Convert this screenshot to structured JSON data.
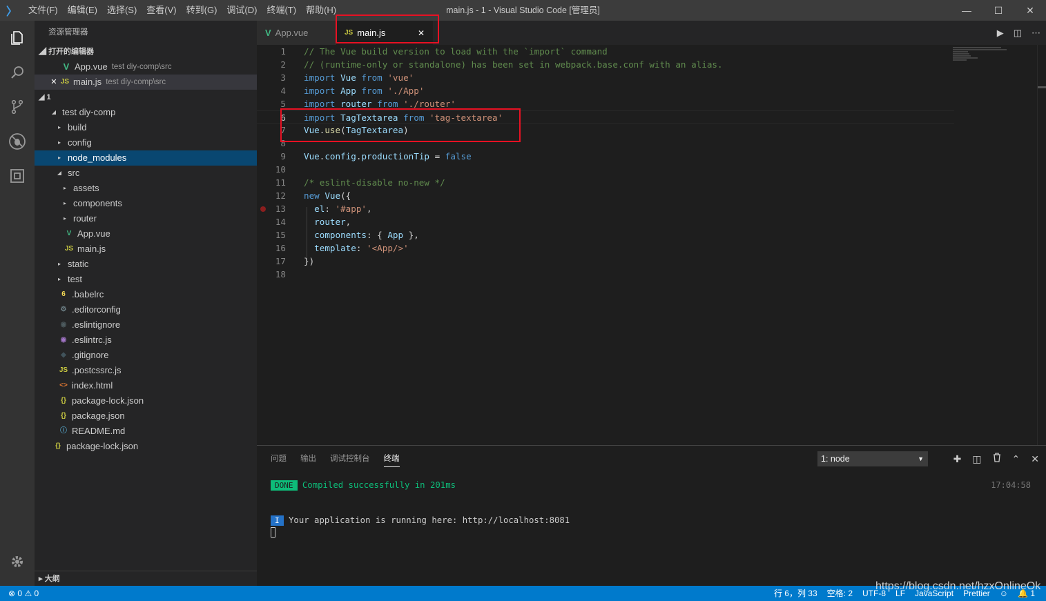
{
  "titlebar": {
    "logo": "〉",
    "menus": [
      "文件(F)",
      "编辑(E)",
      "选择(S)",
      "查看(V)",
      "转到(G)",
      "调试(D)",
      "终端(T)",
      "帮助(H)"
    ],
    "title": "main.js - 1 - Visual Studio Code [管理员]",
    "minimize": "—",
    "maximize": "☐",
    "close": "✕"
  },
  "sidebar": {
    "title": "资源管理器",
    "open_editors_header": "打开的编辑器",
    "open_editors": [
      {
        "name": "App.vue",
        "path": "test diy-comp\\src",
        "icon": "vue-icon",
        "glyph": "V"
      },
      {
        "name": "main.js",
        "path": "test diy-comp\\src",
        "icon": "js-icon",
        "glyph": "JS",
        "close": "✕"
      }
    ],
    "workspace_header": "1",
    "tree": [
      {
        "label": "test diy-comp",
        "kind": "folder-open",
        "depth": 1
      },
      {
        "label": "build",
        "kind": "folder",
        "depth": 2
      },
      {
        "label": "config",
        "kind": "folder",
        "depth": 2
      },
      {
        "label": "node_modules",
        "kind": "folder",
        "depth": 2,
        "selected": true
      },
      {
        "label": "src",
        "kind": "folder-open",
        "depth": 2
      },
      {
        "label": "assets",
        "kind": "folder",
        "depth": 3
      },
      {
        "label": "components",
        "kind": "folder",
        "depth": 3
      },
      {
        "label": "router",
        "kind": "folder",
        "depth": 3
      },
      {
        "label": "App.vue",
        "kind": "vue",
        "depth": 3
      },
      {
        "label": "main.js",
        "kind": "js",
        "depth": 3
      },
      {
        "label": "static",
        "kind": "folder",
        "depth": 2
      },
      {
        "label": "test",
        "kind": "folder",
        "depth": 2
      },
      {
        "label": ".babelrc",
        "kind": "babel",
        "depth": 2
      },
      {
        "label": ".editorconfig",
        "kind": "gear",
        "depth": 2
      },
      {
        "label": ".eslintignore",
        "kind": "eslint-gray",
        "depth": 2
      },
      {
        "label": ".eslintrc.js",
        "kind": "eslint",
        "depth": 2
      },
      {
        "label": ".gitignore",
        "kind": "git",
        "depth": 2
      },
      {
        "label": ".postcssrc.js",
        "kind": "js",
        "depth": 2
      },
      {
        "label": "index.html",
        "kind": "html",
        "depth": 2
      },
      {
        "label": "package-lock.json",
        "kind": "json",
        "depth": 2
      },
      {
        "label": "package.json",
        "kind": "json",
        "depth": 2
      },
      {
        "label": "README.md",
        "kind": "info",
        "depth": 2
      },
      {
        "label": "package-lock.json",
        "kind": "json",
        "depth": 1
      }
    ],
    "outline_header": "大纲"
  },
  "tabs": [
    {
      "label": "App.vue",
      "icon": "vue-icon",
      "glyph": "V",
      "active": false
    },
    {
      "label": "main.js",
      "icon": "js-icon",
      "glyph": "JS",
      "active": true,
      "close": "✕"
    }
  ],
  "editor_actions": {
    "run": "▶",
    "split": "◫",
    "more": "⋯"
  },
  "code": [
    {
      "n": "1",
      "t": [
        [
          "cm",
          "// The Vue build version to load with the `import` command"
        ]
      ]
    },
    {
      "n": "2",
      "t": [
        [
          "cm",
          "// (runtime-only or standalone) has been set in webpack.base.conf with an alias."
        ]
      ]
    },
    {
      "n": "3",
      "t": [
        [
          "kw",
          "import "
        ],
        [
          "vr",
          "Vue "
        ],
        [
          "kw",
          "from "
        ],
        [
          "st",
          "'vue'"
        ]
      ]
    },
    {
      "n": "4",
      "t": [
        [
          "kw",
          "import "
        ],
        [
          "vr",
          "App "
        ],
        [
          "kw",
          "from "
        ],
        [
          "st",
          "'./App'"
        ]
      ]
    },
    {
      "n": "5",
      "t": [
        [
          "kw",
          "import "
        ],
        [
          "vr",
          "router "
        ],
        [
          "kw",
          "from "
        ],
        [
          "st",
          "'./router'"
        ]
      ]
    },
    {
      "n": "6",
      "t": [
        [
          "kw",
          "import "
        ],
        [
          "vr",
          "TagTextarea "
        ],
        [
          "kw",
          "from "
        ],
        [
          "st",
          "'tag-textarea'"
        ]
      ]
    },
    {
      "n": "7",
      "t": [
        [
          "vr",
          "Vue"
        ],
        [
          "tx",
          "."
        ],
        [
          "fn",
          "use"
        ],
        [
          "tx",
          "("
        ],
        [
          "vr",
          "TagTextarea"
        ],
        [
          "tx",
          ")"
        ]
      ]
    },
    {
      "n": "8",
      "t": []
    },
    {
      "n": "9",
      "t": [
        [
          "vr",
          "Vue"
        ],
        [
          "tx",
          "."
        ],
        [
          "vr",
          "config"
        ],
        [
          "tx",
          "."
        ],
        [
          "vr",
          "productionTip"
        ],
        [
          "tx",
          " = "
        ],
        [
          "kw",
          "false"
        ]
      ]
    },
    {
      "n": "10",
      "t": []
    },
    {
      "n": "11",
      "t": [
        [
          "cm",
          "/* eslint-disable no-new */"
        ]
      ]
    },
    {
      "n": "12",
      "t": [
        [
          "kw",
          "new "
        ],
        [
          "vr",
          "Vue"
        ],
        [
          "tx",
          "({"
        ]
      ]
    },
    {
      "n": "13",
      "t": [
        [
          "tx",
          "  "
        ],
        [
          "vr",
          "el"
        ],
        [
          "tx",
          ": "
        ],
        [
          "st",
          "'#app'"
        ],
        [
          "tx",
          ","
        ]
      ]
    },
    {
      "n": "14",
      "t": [
        [
          "tx",
          "  "
        ],
        [
          "vr",
          "router"
        ],
        [
          "tx",
          ","
        ]
      ]
    },
    {
      "n": "15",
      "t": [
        [
          "tx",
          "  "
        ],
        [
          "vr",
          "components"
        ],
        [
          "tx",
          ": { "
        ],
        [
          "vr",
          "App"
        ],
        [
          "tx",
          " },"
        ]
      ]
    },
    {
      "n": "16",
      "t": [
        [
          "tx",
          "  "
        ],
        [
          "vr",
          "template"
        ],
        [
          "tx",
          ": "
        ],
        [
          "st",
          "'<App/>'"
        ]
      ]
    },
    {
      "n": "17",
      "t": [
        [
          "tx",
          "})"
        ]
      ]
    },
    {
      "n": "18",
      "t": []
    }
  ],
  "panel": {
    "tabs": [
      "问题",
      "输出",
      "调试控制台",
      "终端"
    ],
    "active_tab": "终端",
    "terminal_select": "1: node",
    "select_arrow": "▼",
    "actions": {
      "add": "✚",
      "split": "◫",
      "trash": "Ὕ1",
      "maximize": "⌃",
      "close": "✕"
    },
    "done_badge": "DONE",
    "done_text": "Compiled successfully in 201ms",
    "timestamp": "17:04:58",
    "info_badge": "I",
    "info_text": "Your application is running here: http://localhost:8081"
  },
  "status": {
    "errors": "0",
    "warnings": "0",
    "position": "行 6，列 33",
    "spaces": "空格: 2",
    "encoding": "UTF-8",
    "eol": "LF",
    "language": "JavaScript",
    "formatter": "Prettier",
    "notifications": "1"
  },
  "watermark": "https://blog.csdn.net/hzxOnlineOk",
  "colors": {
    "accent": "#007acc",
    "highlight_box": "#e81123",
    "selection": "#094771"
  }
}
